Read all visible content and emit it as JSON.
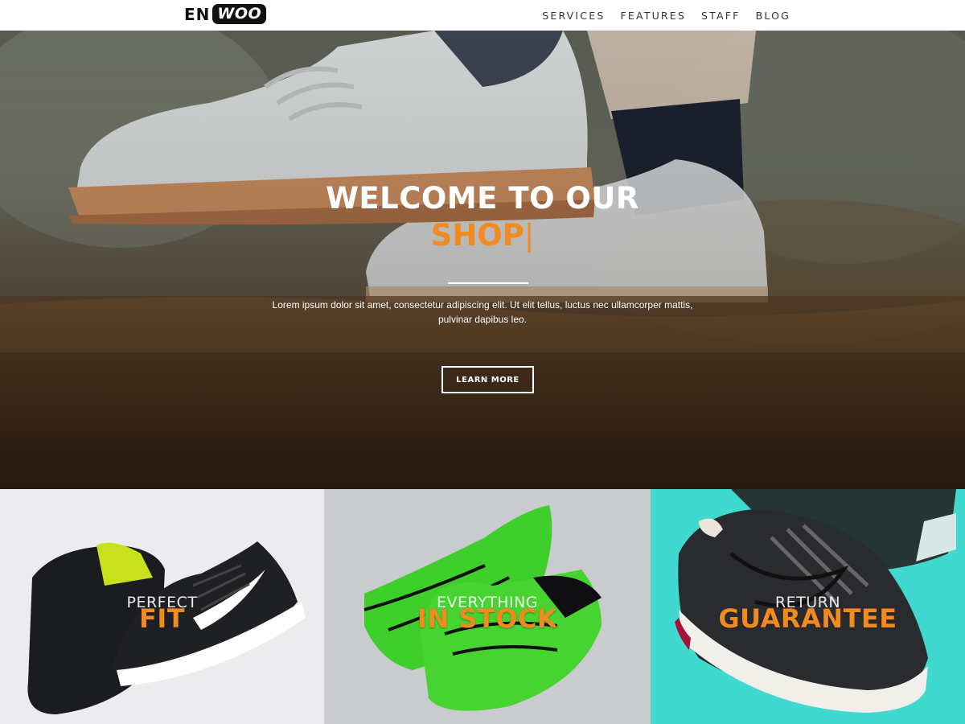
{
  "header": {
    "logo_en": "EN",
    "logo_woo": "WOO",
    "nav": [
      "SERVICES",
      "FEATURES",
      "STAFF",
      "BLOG"
    ]
  },
  "hero": {
    "title": "WELCOME TO OUR",
    "accent": "SHOP",
    "cursor": "|",
    "text_line1": "Lorem ipsum dolor sit amet, consectetur adipiscing elit. Ut elit tellus, luctus nec ullamcorper mattis,",
    "text_line2": "pulvinar dapibus leo.",
    "button": "LEARN MORE"
  },
  "tiles": [
    {
      "small": "PERFECT",
      "big": "FIT"
    },
    {
      "small": "EVERYTHING",
      "big": "IN STOCK"
    },
    {
      "small": "RETURN",
      "big": "GUARANTEE"
    }
  ],
  "colors": {
    "accent": "#f28a1f",
    "header_bg": "#ffffff",
    "tile3_bg": "#3fd9cf"
  }
}
